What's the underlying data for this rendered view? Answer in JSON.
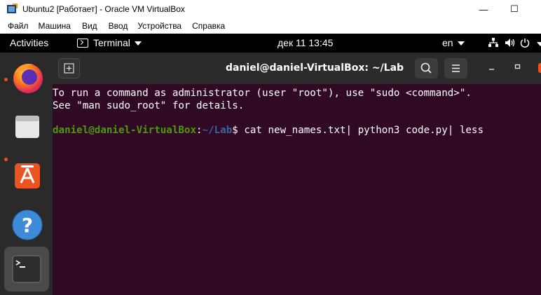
{
  "vbox": {
    "title": "Ubuntu2 [Работает] - Oracle VM VirtualBox",
    "menu": [
      "Файл",
      "Машина",
      "Вид",
      "Ввод",
      "Устройства",
      "Справка"
    ],
    "controls": {
      "minimize": "—",
      "maximize": "☐"
    }
  },
  "topbar": {
    "activities": "Activities",
    "app_menu": "Terminal",
    "clock": "дек 11  13:45",
    "lang": "en"
  },
  "dock": {
    "items": [
      "firefox",
      "files",
      "software",
      "help",
      "terminal"
    ]
  },
  "terminal": {
    "title": "daniel@daniel-VirtualBox: ~/Lab",
    "lines": [
      "To run a command as administrator (user \"root\"), use \"sudo <command>\".",
      "See \"man sudo_root\" for details."
    ],
    "prompt": {
      "user_host": "daniel@daniel-VirtualBox",
      "colon": ":",
      "path": "~/Lab",
      "dollar": "$",
      "command": " cat new_names.txt| python3 code.py| less"
    }
  }
}
